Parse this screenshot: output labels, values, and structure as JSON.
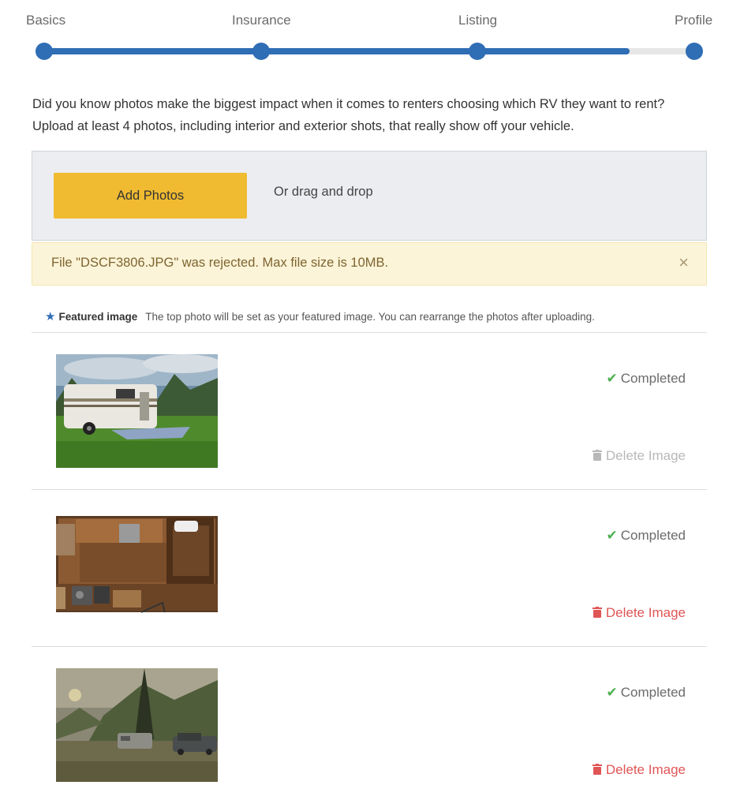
{
  "stepper": {
    "steps": [
      {
        "label": "Basics"
      },
      {
        "label": "Insurance"
      },
      {
        "label": "Listing"
      },
      {
        "label": "Profile"
      }
    ],
    "progress": 0.9,
    "accent_color": "#2f6db5"
  },
  "intro": {
    "line1": "Did you know photos make the biggest impact when it comes to renters choosing which RV they want to rent?",
    "line2": "Upload at least 4 photos, including interior and exterior shots, that really show off your vehicle."
  },
  "upload": {
    "add_button_label": "Add Photos",
    "add_button_color": "#f0bb31",
    "drag_text": "Or drag and drop"
  },
  "alert": {
    "message": "File \"DSCF3806.JPG\" was rejected. Max file size is 10MB.",
    "close_label": "×"
  },
  "featured": {
    "icon": "star-icon",
    "title": "Featured image",
    "description": "The top photo will be set as your featured image. You can rearrange the photos after uploading."
  },
  "photos": [
    {
      "icon": "rv-camper-photo",
      "status": "Completed",
      "delete_label": "Delete Image",
      "delete_enabled": false
    },
    {
      "icon": "floor-plan-photo",
      "status": "Completed",
      "delete_label": "Delete Image",
      "delete_enabled": true
    },
    {
      "icon": "campsite-photo",
      "status": "Completed",
      "delete_label": "Delete Image",
      "delete_enabled": true
    }
  ]
}
